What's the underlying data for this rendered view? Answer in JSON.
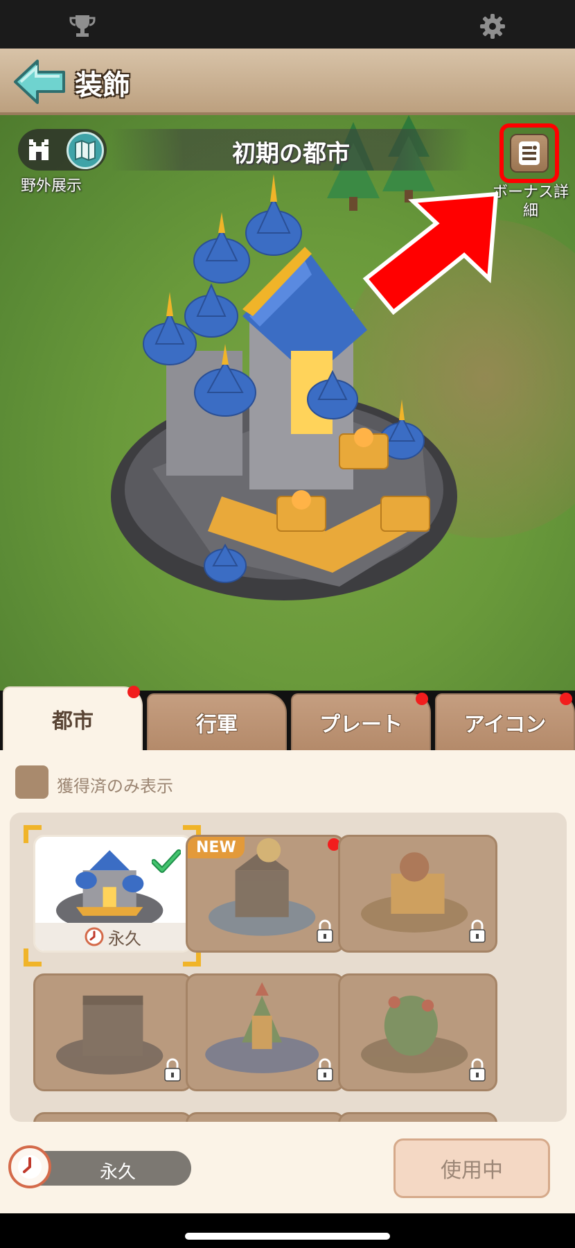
{
  "header": {
    "title": "装飾"
  },
  "scene": {
    "city_title": "初期の都市",
    "view_toggle_label": "野外展示",
    "bonus_label": "ボーナス詳細"
  },
  "tabs": [
    {
      "label": "都市",
      "active": true,
      "notify": true
    },
    {
      "label": "行軍",
      "active": false,
      "notify": false
    },
    {
      "label": "プレート",
      "active": false,
      "notify": true
    },
    {
      "label": "アイコン",
      "active": false,
      "notify": true
    }
  ],
  "filter": {
    "label": "獲得済のみ表示",
    "checked": false
  },
  "items": [
    {
      "selected": true,
      "badge": "",
      "notify": false,
      "locked": false,
      "duration": "永久"
    },
    {
      "selected": false,
      "badge": "NEW",
      "notify": true,
      "locked": true
    },
    {
      "selected": false,
      "badge": "",
      "notify": false,
      "locked": true
    },
    {
      "selected": false,
      "badge": "",
      "notify": false,
      "locked": true
    },
    {
      "selected": false,
      "badge": "",
      "notify": false,
      "locked": true
    },
    {
      "selected": false,
      "badge": "",
      "notify": false,
      "locked": true
    }
  ],
  "footer": {
    "duration": "永久",
    "use_button": "使用中"
  },
  "colors": {
    "accent_red": "#ff0000",
    "tab_bg": "#b48a6a",
    "panel_bg": "#fbf3e7",
    "frame_gold": "#f0b429"
  }
}
